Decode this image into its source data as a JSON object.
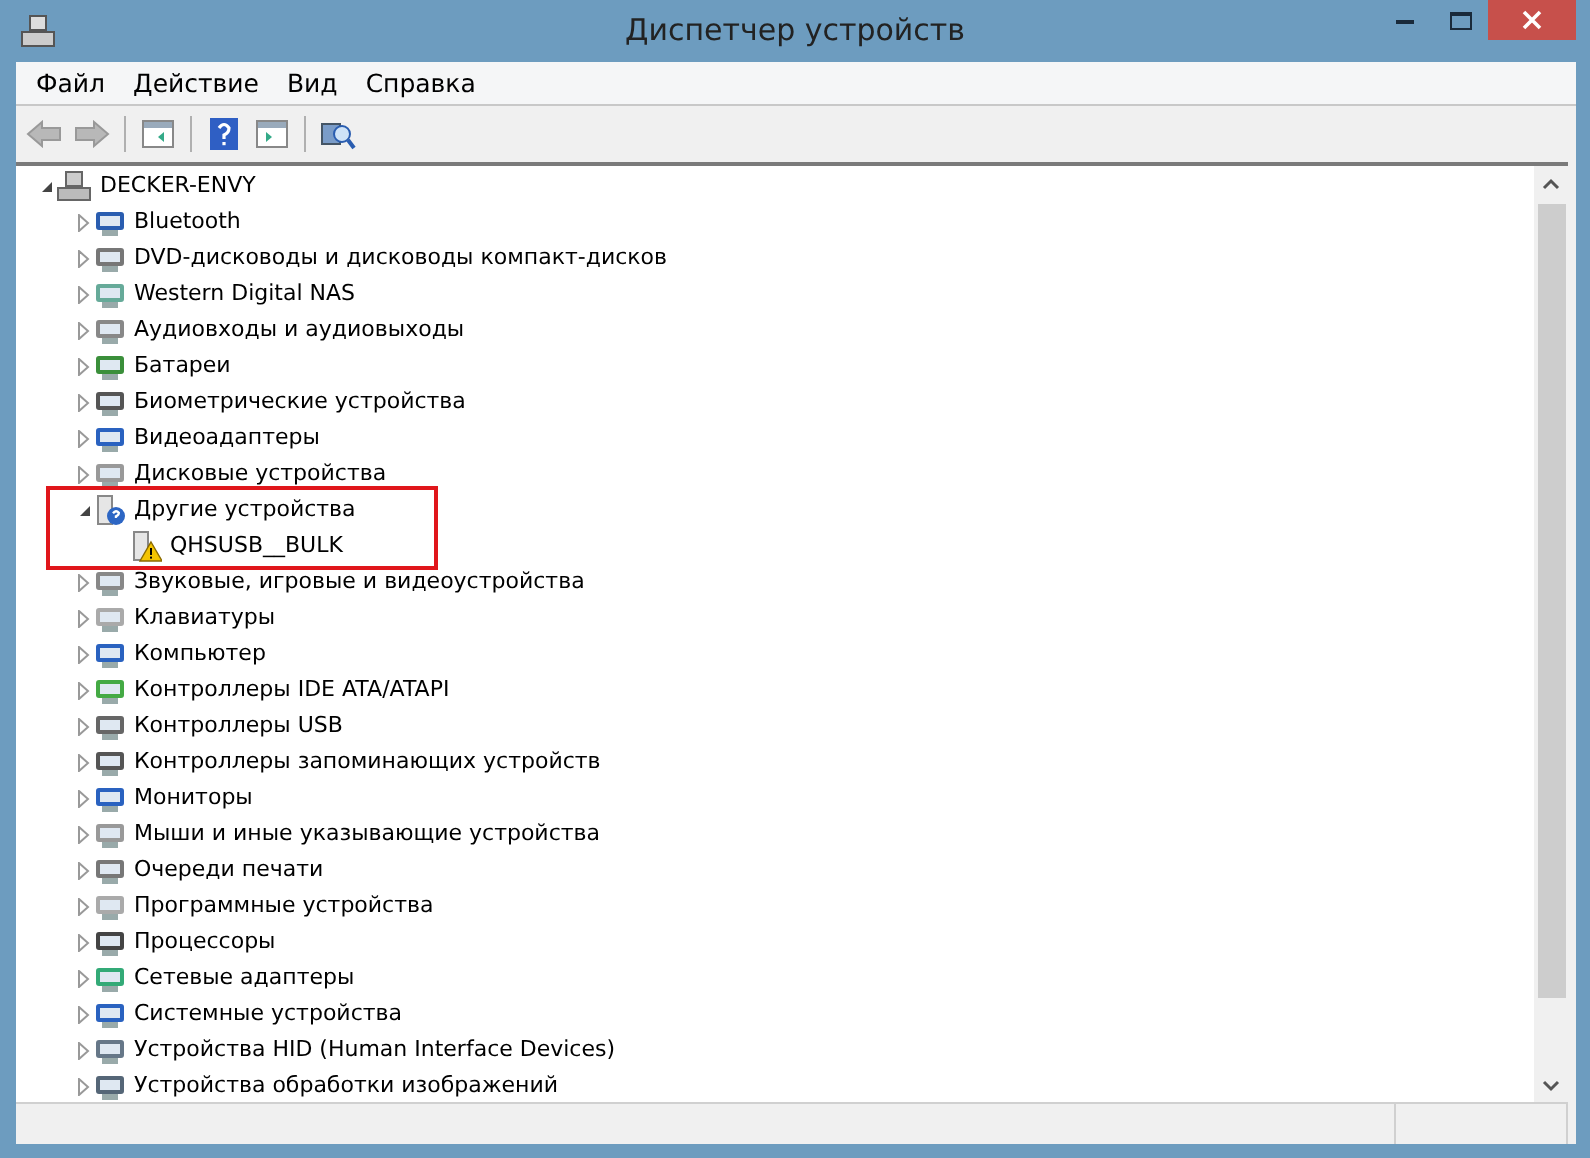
{
  "window": {
    "title": "Диспетчер устройств"
  },
  "menu": [
    "Файл",
    "Действие",
    "Вид",
    "Справка"
  ],
  "toolbar": {
    "back_disabled": true,
    "forward_disabled": true
  },
  "tree": {
    "label": "DECKER-ENVY",
    "expanded": true,
    "children": [
      {
        "label": "Bluetooth",
        "expanded": false
      },
      {
        "label": "DVD-дисководы и дисководы компакт-дисков",
        "expanded": false
      },
      {
        "label": "Western Digital NAS",
        "expanded": false
      },
      {
        "label": "Аудиовходы и аудиовыходы",
        "expanded": false
      },
      {
        "label": "Батареи",
        "expanded": false
      },
      {
        "label": "Биометрические устройства",
        "expanded": false
      },
      {
        "label": "Видеоадаптеры",
        "expanded": false
      },
      {
        "label": "Дисковые устройства",
        "expanded": false
      },
      {
        "label": "Другие устройства",
        "expanded": true,
        "children": [
          {
            "label": "QHSUSB__BULK",
            "warning": true
          }
        ]
      },
      {
        "label": "Звуковые, игровые и видеоустройства",
        "expanded": false
      },
      {
        "label": "Клавиатуры",
        "expanded": false
      },
      {
        "label": "Компьютер",
        "expanded": false
      },
      {
        "label": "Контроллеры IDE ATA/ATAPI",
        "expanded": false
      },
      {
        "label": "Контроллеры USB",
        "expanded": false
      },
      {
        "label": "Контроллеры запоминающих устройств",
        "expanded": false
      },
      {
        "label": "Мониторы",
        "expanded": false
      },
      {
        "label": "Мыши и иные указывающие устройства",
        "expanded": false
      },
      {
        "label": "Очереди печати",
        "expanded": false
      },
      {
        "label": "Программные устройства",
        "expanded": false
      },
      {
        "label": "Процессоры",
        "expanded": false
      },
      {
        "label": "Сетевые адаптеры",
        "expanded": false
      },
      {
        "label": "Системные устройства",
        "expanded": false
      },
      {
        "label": "Устройства HID (Human Interface Devices)",
        "expanded": false
      },
      {
        "label": "Устройства обработки изображений",
        "expanded": false
      }
    ]
  }
}
